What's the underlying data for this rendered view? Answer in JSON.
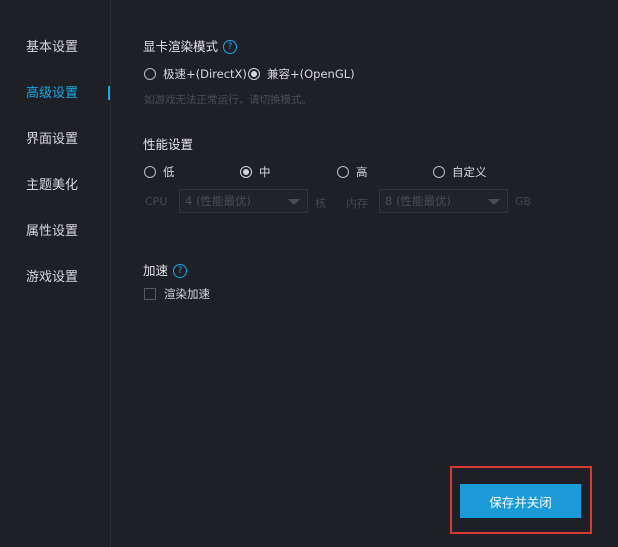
{
  "sidebar": {
    "items": [
      {
        "label": "基本设置",
        "active": false
      },
      {
        "label": "高级设置",
        "active": true
      },
      {
        "label": "界面设置",
        "active": false
      },
      {
        "label": "主题美化",
        "active": false
      },
      {
        "label": "属性设置",
        "active": false
      },
      {
        "label": "游戏设置",
        "active": false
      }
    ],
    "accent": "#1aa8e5"
  },
  "render": {
    "title": "显卡渲染模式",
    "help": "?",
    "options": [
      "极速+(DirectX)",
      "兼容+(OpenGL)"
    ],
    "selected": "兼容+(OpenGL)",
    "hint": "如游戏无法正常运行，请切换模式。"
  },
  "performance": {
    "title": "性能设置",
    "options": [
      "低",
      "中",
      "高",
      "自定义"
    ],
    "selected": "中",
    "cpu_label": "CPU",
    "cpu_value": "4 (性能最优)",
    "cpu_unit": "核",
    "mem_label": "内存",
    "mem_value": "8 (性能最优)",
    "mem_unit": "GB"
  },
  "accel": {
    "title": "加速",
    "help": "?",
    "checkbox_label": "渲染加速",
    "checked": false
  },
  "footer": {
    "save_label": "保存并关闭",
    "button_color": "#1a9ad6",
    "highlight_color": "#d33b34"
  }
}
